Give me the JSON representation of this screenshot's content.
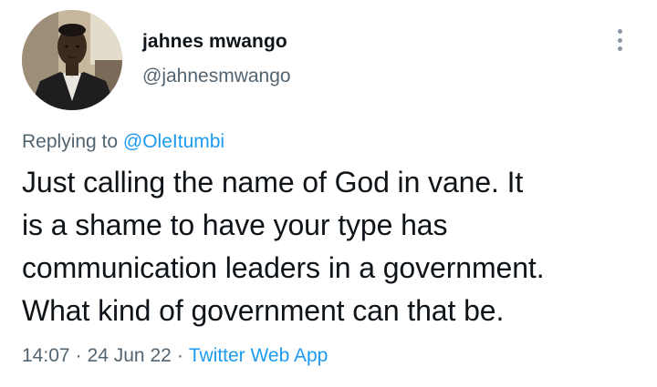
{
  "tweet": {
    "author": {
      "display_name": "jahnes mwango",
      "handle": "@jahnesmwango"
    },
    "more_icon": "more-options-icon",
    "replying_to": {
      "prefix": "Replying to ",
      "mention": "@OleItumbi"
    },
    "text_lines": [
      "Just calling the name of God in vane. It",
      "is a shame to have your type has",
      "communication leaders in a government.",
      "What kind of government can that be."
    ],
    "meta": {
      "time": "14:07",
      "separator": "·",
      "date": "24 Jun 22",
      "source": "Twitter Web App"
    },
    "colors": {
      "link": "#1d9bf0",
      "secondary_text": "#536471",
      "primary_text": "#0f1419"
    }
  }
}
